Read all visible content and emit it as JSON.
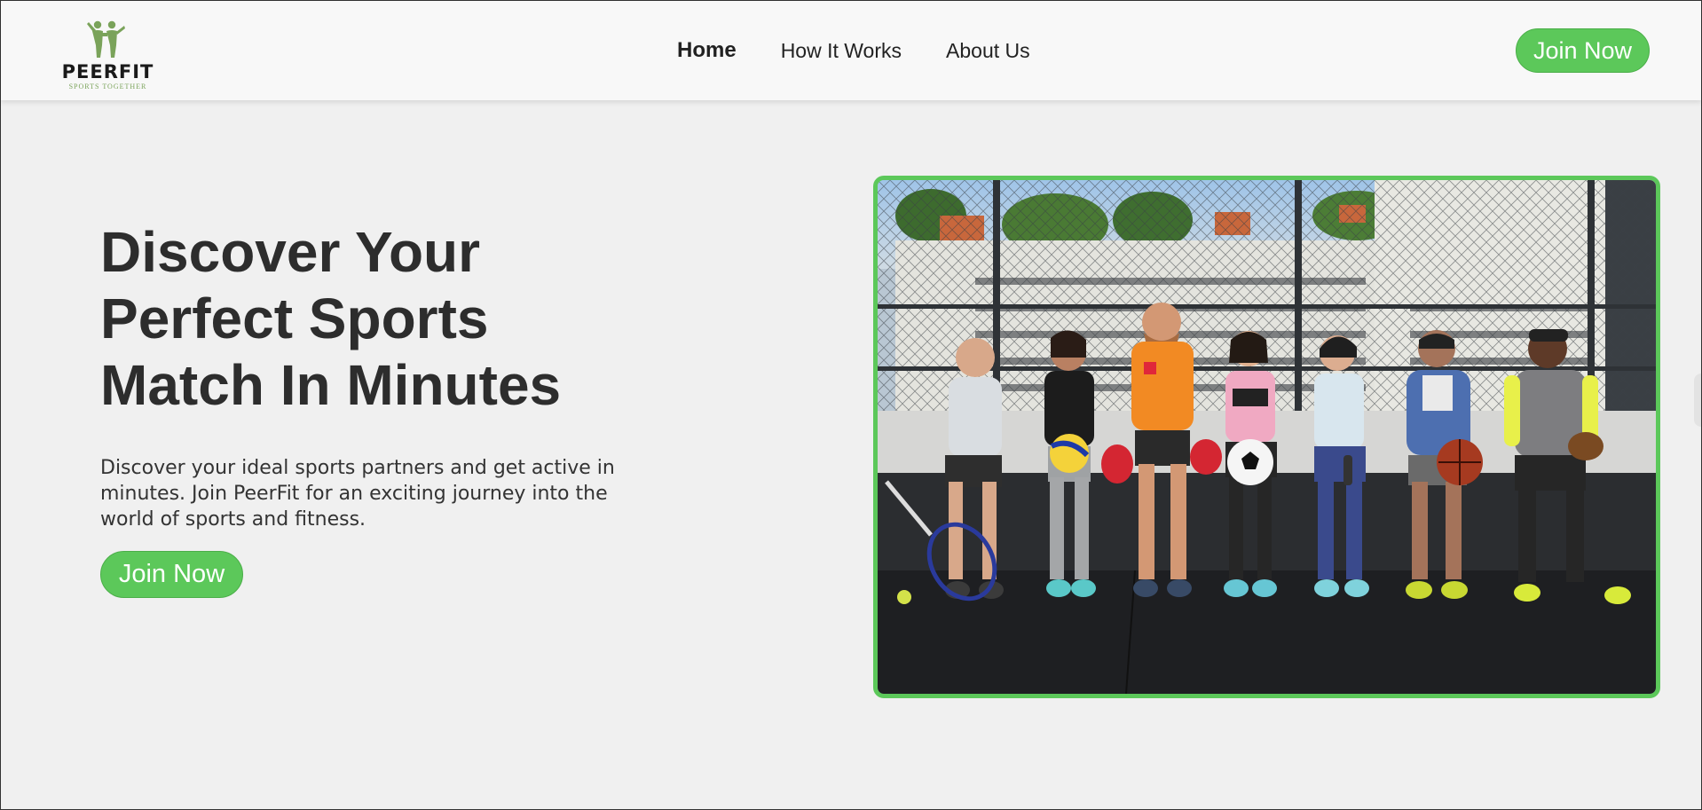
{
  "brand": {
    "name": "PEERFIT",
    "tagline": "SPORTS TOGETHER",
    "color": "#5cc85a"
  },
  "nav": {
    "items": [
      {
        "label": "Home",
        "active": true
      },
      {
        "label": "How It Works",
        "active": false
      },
      {
        "label": "About Us",
        "active": false
      }
    ],
    "cta_label": "Join Now"
  },
  "hero": {
    "title_lines": [
      "Discover Your",
      "Perfect Sports",
      "Match In Minutes"
    ],
    "description": "Discover your ideal sports partners and get active in minutes. Join PeerFit for an exciting journey into the world of sports and fitness.",
    "cta_label": "Join Now"
  },
  "photo": {
    "subject": "group-of-athletes-photo"
  }
}
